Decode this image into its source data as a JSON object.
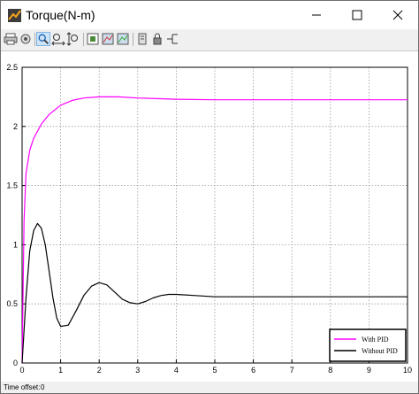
{
  "window": {
    "title": "Torque(N-m)"
  },
  "toolbar": {
    "buttons": [
      "print-icon",
      "print-setup-icon",
      "zoom-in-icon",
      "zoom-x-icon",
      "zoom-y-icon",
      "autoscale-icon",
      "save-axes-icon",
      "restore-axes-icon",
      "parameters-icon",
      "lock-icon",
      "signal-selector-icon"
    ]
  },
  "status": {
    "label": "Time offset:",
    "value": "0"
  },
  "chart_data": {
    "type": "line",
    "title": "",
    "xlabel": "",
    "ylabel": "",
    "xlim": [
      0,
      10
    ],
    "ylim": [
      0,
      2.5
    ],
    "x_ticks": [
      "0",
      "1",
      "2",
      "3",
      "4",
      "5",
      "6",
      "7",
      "8",
      "9",
      "10"
    ],
    "y_ticks": [
      "0",
      "0.5",
      "1",
      "1.5",
      "2",
      "2.5"
    ],
    "grid": true,
    "legend_position": "bottom-right",
    "series": [
      {
        "name": "With PID",
        "color": "#ff00ff",
        "x": [
          0,
          0.05,
          0.1,
          0.2,
          0.3,
          0.5,
          0.7,
          1.0,
          1.3,
          1.6,
          2.0,
          2.5,
          3.0,
          3.5,
          4.0,
          5.0,
          6.0,
          7.0,
          8.0,
          9.0,
          10.0
        ],
        "y": [
          0,
          1.2,
          1.6,
          1.8,
          1.9,
          2.02,
          2.1,
          2.18,
          2.22,
          2.24,
          2.25,
          2.25,
          2.24,
          2.235,
          2.23,
          2.225,
          2.225,
          2.225,
          2.225,
          2.225,
          2.225
        ]
      },
      {
        "name": "Without PID",
        "color": "#000000",
        "x": [
          0,
          0.1,
          0.2,
          0.3,
          0.4,
          0.5,
          0.6,
          0.7,
          0.8,
          0.9,
          1.0,
          1.2,
          1.4,
          1.6,
          1.8,
          2.0,
          2.2,
          2.4,
          2.6,
          2.8,
          3.0,
          3.2,
          3.4,
          3.6,
          3.8,
          4.0,
          4.5,
          5.0,
          6.0,
          7.0,
          8.0,
          9.0,
          10.0
        ],
        "y": [
          0,
          0.55,
          0.95,
          1.12,
          1.18,
          1.14,
          1.0,
          0.78,
          0.55,
          0.38,
          0.31,
          0.32,
          0.44,
          0.57,
          0.65,
          0.68,
          0.66,
          0.6,
          0.54,
          0.51,
          0.5,
          0.52,
          0.55,
          0.57,
          0.58,
          0.58,
          0.57,
          0.56,
          0.56,
          0.56,
          0.56,
          0.56,
          0.56
        ]
      }
    ]
  }
}
